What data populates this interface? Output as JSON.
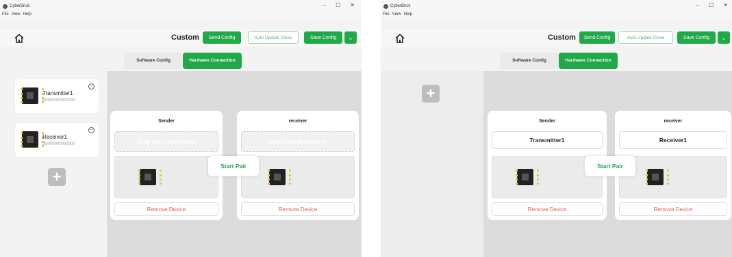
{
  "app": {
    "title": "CyberBrick"
  },
  "window_controls": {
    "minimize": "–",
    "maximize": "☐",
    "close": "✕"
  },
  "menu": [
    "File",
    "View",
    "Help"
  ],
  "toolbar": {
    "mode_title": "Custom",
    "send_config": "Send Config",
    "auto_update_close": "Auto Update Close",
    "save_config": "Save Config",
    "dropdown_glyph": "⌄"
  },
  "tabs": {
    "software": "Software Config",
    "hardware": "Hardware Connection"
  },
  "sidebar": {
    "devices": [
      {
        "name": "Transmitter1",
        "id": "3U000000000000"
      },
      {
        "name": "Receiver1",
        "id": "3U000000000000"
      }
    ],
    "add_glyph": "+"
  },
  "left_view": {
    "sender": {
      "title": "Sender",
      "drop_hint": "Drag Core Board Here",
      "remove": "Remove Device"
    },
    "receiver": {
      "title": "receiver",
      "drop_hint": "Drag Core Board Here",
      "remove": "Remove Device"
    },
    "pair": "Start Pair"
  },
  "right_view": {
    "sender": {
      "title": "Sender",
      "device": "Transmitter1",
      "remove": "Remove Device"
    },
    "receiver": {
      "title": "receiver",
      "device": "Receiver1",
      "remove": "Remove Device"
    },
    "pair": "Start Pair"
  },
  "colors": {
    "accent": "#20a849",
    "danger": "#e0614f"
  }
}
